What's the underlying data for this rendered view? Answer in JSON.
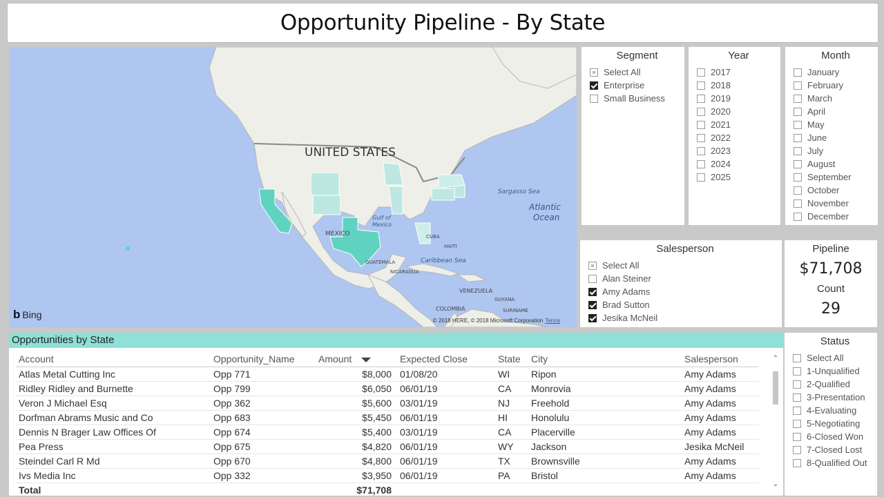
{
  "title": "Opportunity Pipeline - By State",
  "map": {
    "country_label": "UNITED STATES",
    "labels": {
      "mexico": "MEXICO",
      "cuba": "CUBA",
      "haiti": "HAITI",
      "guatemala": "GUATEMALA",
      "nicaragua": "NICARAGUA",
      "venezuela": "VENEZUELA",
      "colombia": "COLOMBIA",
      "guyana": "GUYANA",
      "suriname": "SURINAME",
      "sargasso": "Sargasso Sea",
      "atlantic1": "Atlantic",
      "atlantic2": "Ocean",
      "gulf1": "Gulf of",
      "gulf2": "Mexico",
      "caribbean": "Caribbean Sea"
    },
    "bing": "Bing",
    "copyright": "© 2018 HERE, © 2018 Microsoft Corporation",
    "terms": "Terms",
    "highlight_color": "#5fd3c0",
    "light_color": "#bde8e2",
    "ocean_color": "#aec6f0",
    "land_color": "#efefe9"
  },
  "segment": {
    "title": "Segment",
    "items": [
      {
        "label": "Select All",
        "state": "partial"
      },
      {
        "label": "Enterprise",
        "state": "checked"
      },
      {
        "label": "Small Business",
        "state": "unchecked"
      }
    ]
  },
  "year": {
    "title": "Year",
    "items": [
      {
        "label": "2017",
        "state": "unchecked"
      },
      {
        "label": "2018",
        "state": "unchecked"
      },
      {
        "label": "2019",
        "state": "unchecked"
      },
      {
        "label": "2020",
        "state": "unchecked"
      },
      {
        "label": "2021",
        "state": "unchecked"
      },
      {
        "label": "2022",
        "state": "unchecked"
      },
      {
        "label": "2023",
        "state": "unchecked"
      },
      {
        "label": "2024",
        "state": "unchecked"
      },
      {
        "label": "2025",
        "state": "unchecked"
      }
    ]
  },
  "month": {
    "title": "Month",
    "items": [
      {
        "label": "January",
        "state": "unchecked"
      },
      {
        "label": "February",
        "state": "unchecked"
      },
      {
        "label": "March",
        "state": "unchecked"
      },
      {
        "label": "April",
        "state": "unchecked"
      },
      {
        "label": "May",
        "state": "unchecked"
      },
      {
        "label": "June",
        "state": "unchecked"
      },
      {
        "label": "July",
        "state": "unchecked"
      },
      {
        "label": "August",
        "state": "unchecked"
      },
      {
        "label": "September",
        "state": "unchecked"
      },
      {
        "label": "October",
        "state": "unchecked"
      },
      {
        "label": "November",
        "state": "unchecked"
      },
      {
        "label": "December",
        "state": "unchecked"
      }
    ]
  },
  "salesperson": {
    "title": "Salesperson",
    "items": [
      {
        "label": "Select All",
        "state": "partial"
      },
      {
        "label": "Alan Steiner",
        "state": "unchecked"
      },
      {
        "label": "Amy Adams",
        "state": "checked"
      },
      {
        "label": "Brad Sutton",
        "state": "checked"
      },
      {
        "label": "Jesika McNeil",
        "state": "checked"
      }
    ]
  },
  "pipeline": {
    "label": "Pipeline",
    "value": "$71,708",
    "count_label": "Count",
    "count": "29"
  },
  "status": {
    "title": "Status",
    "items": [
      {
        "label": "Select All",
        "state": "unchecked"
      },
      {
        "label": "1-Unqualified",
        "state": "unchecked"
      },
      {
        "label": "2-Qualified",
        "state": "unchecked"
      },
      {
        "label": "3-Presentation",
        "state": "unchecked"
      },
      {
        "label": "4-Evaluating",
        "state": "unchecked"
      },
      {
        "label": "5-Negotiating",
        "state": "unchecked"
      },
      {
        "label": "6-Closed Won",
        "state": "unchecked"
      },
      {
        "label": "7-Closed Lost",
        "state": "unchecked"
      },
      {
        "label": "8-Qualified Out",
        "state": "unchecked"
      }
    ]
  },
  "table": {
    "title": "Opportunities by State",
    "columns": [
      "Account",
      "Opportunity_Name",
      "Amount",
      "Expected Close",
      "State",
      "City",
      "Salesperson"
    ],
    "rows": [
      [
        "Atlas Metal Cutting Inc",
        "Opp 771",
        "$8,000",
        "01/08/20",
        "WI",
        "Ripon",
        "Amy Adams"
      ],
      [
        "Ridley Ridley  and Burnette",
        "Opp 799",
        "$6,050",
        "06/01/19",
        "CA",
        "Monrovia",
        "Amy Adams"
      ],
      [
        "Veron J Michael Esq",
        "Opp 362",
        "$5,600",
        "03/01/19",
        "NJ",
        "Freehold",
        "Amy Adams"
      ],
      [
        "Dorfman Abrams Music  and Co",
        "Opp 683",
        "$5,450",
        "06/01/19",
        "HI",
        "Honolulu",
        "Amy Adams"
      ],
      [
        "Dennis N Brager Law Offices Of",
        "Opp 674",
        "$5,400",
        "03/01/19",
        "CA",
        "Placerville",
        "Amy Adams"
      ],
      [
        "Pea Press",
        "Opp 675",
        "$4,820",
        "06/01/19",
        "WY",
        "Jackson",
        "Jesika McNeil"
      ],
      [
        "Steindel Carl R Md",
        "Opp 670",
        "$4,800",
        "06/01/19",
        "TX",
        "Brownsville",
        "Amy Adams"
      ],
      [
        "Ivs Media Inc",
        "Opp 332",
        "$3,950",
        "06/01/19",
        "PA",
        "Bristol",
        "Amy Adams"
      ]
    ],
    "total_label": "Total",
    "total_amount": "$71,708"
  }
}
